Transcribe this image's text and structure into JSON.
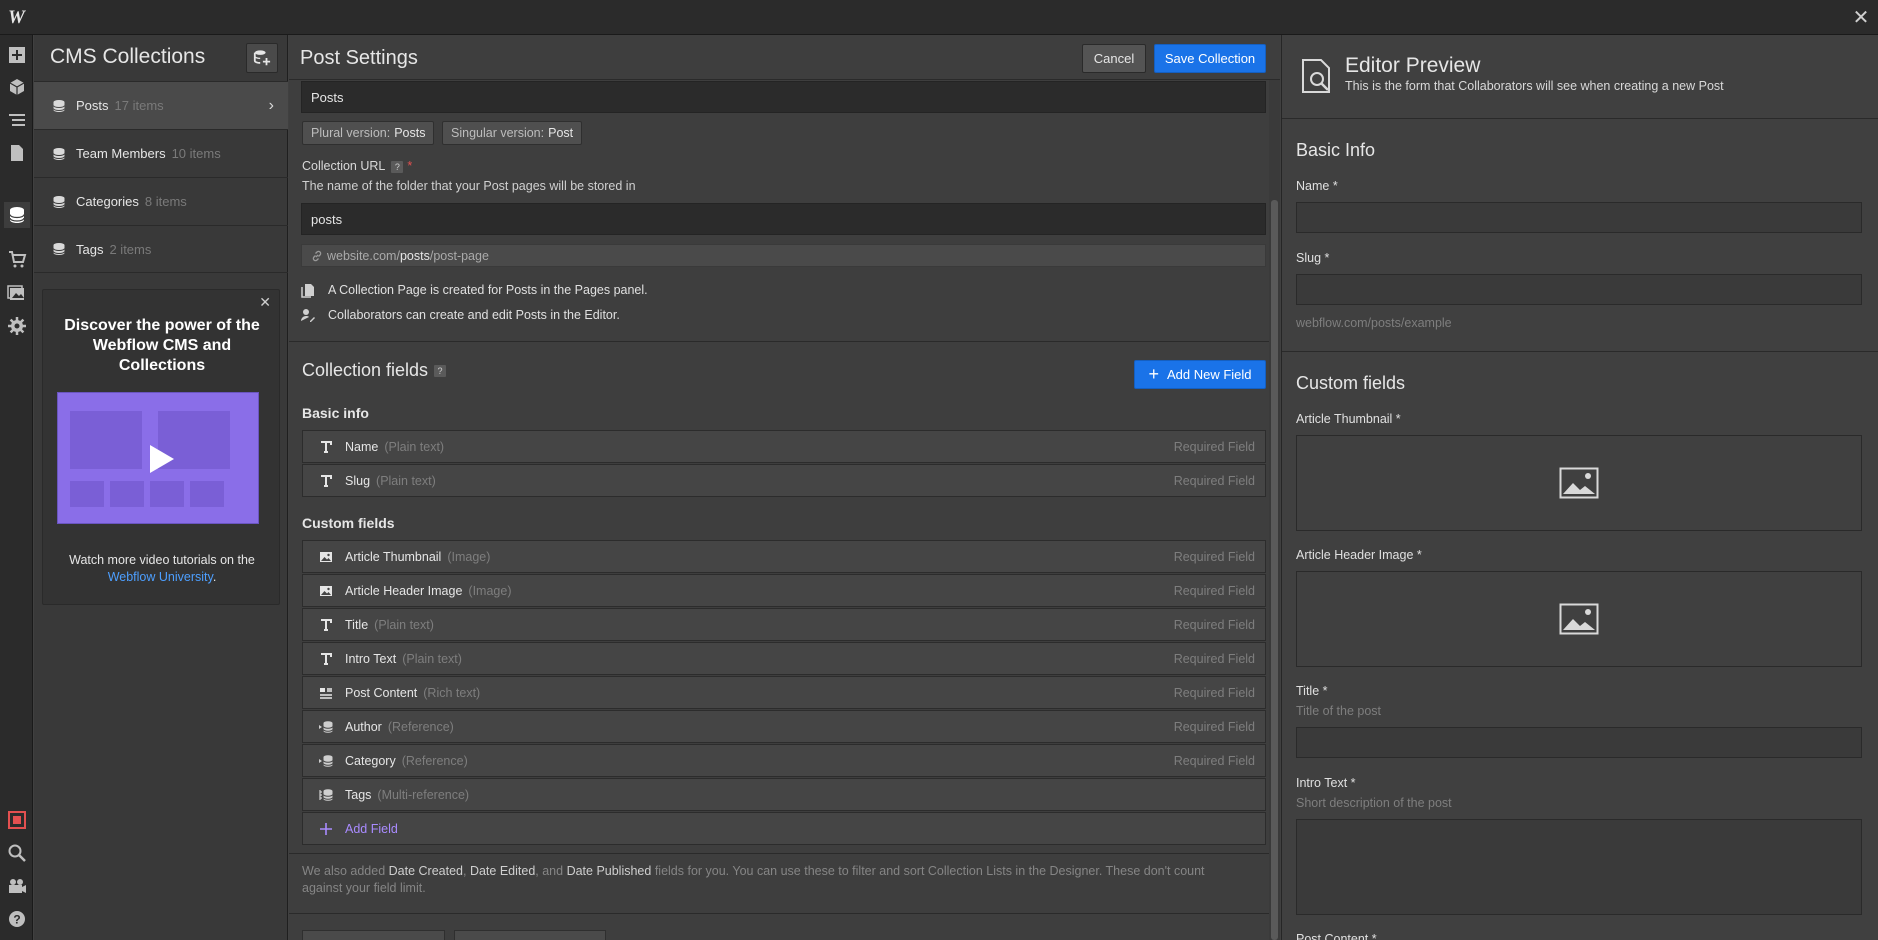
{
  "topbar": {
    "logo": "W",
    "close": "✕"
  },
  "cms": {
    "title": "CMS Collections",
    "collections": [
      {
        "name": "Posts",
        "count": "17 items",
        "active": true
      },
      {
        "name": "Team Members",
        "count": "10 items"
      },
      {
        "name": "Categories",
        "count": "8 items"
      },
      {
        "name": "Tags",
        "count": "2 items"
      }
    ],
    "promo": {
      "heading": "Discover the power of the Webflow CMS and Collections",
      "text": "Watch more video tutorials on the",
      "link": "Webflow University",
      "period": "."
    }
  },
  "settings": {
    "title": "Post Settings",
    "cancel": "Cancel",
    "save": "Save Collection",
    "name_value": "Posts",
    "plural_label": "Plural version:",
    "plural_value": "Posts",
    "singular_label": "Singular version:",
    "singular_value": "Post",
    "url_label": "Collection URL",
    "help": "?",
    "required_star": "*",
    "url_help": "The name of the folder that your Post pages will be stored in",
    "url_value": "posts",
    "url_preview_prefix": "website.com/",
    "url_preview_bold": "posts",
    "url_preview_suffix": "/post-page",
    "info1": "A Collection Page is created for Posts in the Pages panel.",
    "info2": "Collaborators can create and edit Posts in the Editor.",
    "fields_title": "Collection fields",
    "add_new_field": "Add New Field",
    "add_plus": "+",
    "basic_title": "Basic info",
    "custom_title": "Custom fields",
    "basic_fields": [
      {
        "name": "Name",
        "type": "(Plain text)",
        "req": "Required Field",
        "icon": "text-icon"
      },
      {
        "name": "Slug",
        "type": "(Plain text)",
        "req": "Required Field",
        "icon": "text-icon"
      }
    ],
    "custom_fields": [
      {
        "name": "Article Thumbnail",
        "type": "(Image)",
        "req": "Required Field",
        "icon": "image-icon"
      },
      {
        "name": "Article Header Image",
        "type": "(Image)",
        "req": "Required Field",
        "icon": "image-icon"
      },
      {
        "name": "Title",
        "type": "(Plain text)",
        "req": "Required Field",
        "icon": "text-icon"
      },
      {
        "name": "Intro Text",
        "type": "(Plain text)",
        "req": "Required Field",
        "icon": "text-icon"
      },
      {
        "name": "Post Content",
        "type": "(Rich text)",
        "req": "Required Field",
        "icon": "rich-text-icon"
      },
      {
        "name": "Author",
        "type": "(Reference)",
        "req": "Required Field",
        "icon": "reference-icon"
      },
      {
        "name": "Category",
        "type": "(Reference)",
        "req": "Required Field",
        "icon": "reference-icon"
      },
      {
        "name": "Tags",
        "type": "(Multi-reference)",
        "req": "",
        "icon": "multi-reference-icon"
      }
    ],
    "add_field": "Add Field",
    "footnote_1": "We also added ",
    "footnote_b1": "Date Created",
    "footnote_2": ", ",
    "footnote_b2": "Date Edited",
    "footnote_3": ", and ",
    "footnote_b3": "Date Published",
    "footnote_4": " fields for you. You can use these to filter and sort Collection Lists in the Designer. These don't count against your field limit."
  },
  "preview": {
    "title": "Editor Preview",
    "subtitle": "This is the form that Collaborators will see when creating a new Post",
    "basic_title": "Basic Info",
    "name_label": "Name *",
    "slug_label": "Slug *",
    "slug_hint": "webflow.com/posts/example",
    "custom_title": "Custom fields",
    "thumb_label": "Article Thumbnail *",
    "header_label": "Article Header Image *",
    "title_label": "Title *",
    "title_hint": "Title of the post",
    "intro_label": "Intro Text *",
    "intro_hint": "Short description of the post",
    "content_label": "Post Content *"
  },
  "colors": {
    "accent": "#1a73e8",
    "link": "#4d9fff",
    "add_field": "#a98bff",
    "required": "#e35050"
  }
}
